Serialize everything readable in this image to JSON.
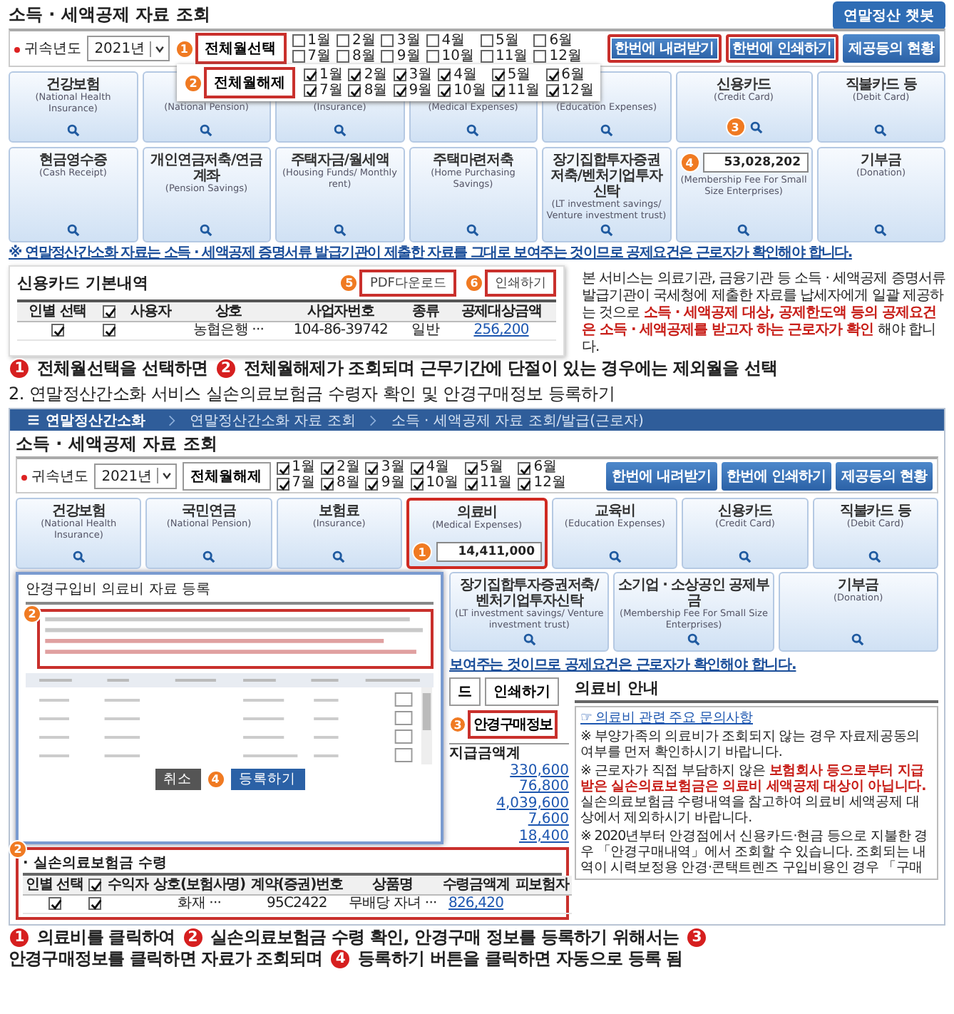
{
  "section_1": {
    "screen": {
      "title": "소득 · 세액공제 자료 조회",
      "chatbot_button": "연말정산 챗봇",
      "year_label": "귀속년도",
      "year_value": "2021년",
      "month_button": {
        "label": "전체월선택",
        "marker": "1"
      },
      "months": [
        {
          "label": "1월",
          "checked": false
        },
        {
          "label": "2월",
          "checked": false
        },
        {
          "label": "3월",
          "checked": false
        },
        {
          "label": "4월",
          "checked": false
        },
        {
          "label": "5월",
          "checked": false
        },
        {
          "label": "6월",
          "checked": false
        },
        {
          "label": "7월",
          "checked": false
        },
        {
          "label": "8월",
          "checked": false
        },
        {
          "label": "9월",
          "checked": false
        },
        {
          "label": "10월",
          "checked": false
        },
        {
          "label": "11월",
          "checked": false
        },
        {
          "label": "12월",
          "checked": false
        }
      ],
      "action_buttons": [
        {
          "label": "한번에 내려받기",
          "highlighted": true
        },
        {
          "label": "한번에 인쇄하기",
          "highlighted": true
        },
        {
          "label": "제공등의 현황",
          "highlighted": false
        }
      ],
      "month_popup": {
        "button": {
          "label": "전체월해제",
          "marker": "2"
        },
        "months": [
          {
            "label": "1월",
            "checked": true
          },
          {
            "label": "2월",
            "checked": true
          },
          {
            "label": "3월",
            "checked": true
          },
          {
            "label": "4월",
            "checked": true
          },
          {
            "label": "5월",
            "checked": true
          },
          {
            "label": "6월",
            "checked": true
          },
          {
            "label": "7월",
            "checked": true
          },
          {
            "label": "8월",
            "checked": true
          },
          {
            "label": "9월",
            "checked": true
          },
          {
            "label": "10월",
            "checked": true
          },
          {
            "label": "11월",
            "checked": true
          },
          {
            "label": "12월",
            "checked": true
          }
        ]
      },
      "tiles": [
        {
          "name": "건강보험",
          "english": "(National Health Insurance)"
        },
        {
          "english": "(National Pension)"
        },
        {
          "english": "(Insurance)"
        },
        {
          "english": "(Medical Expenses)"
        },
        {
          "english": "(Education Expenses)"
        },
        {
          "name": "신용카드",
          "english": "(Credit Card)",
          "marker": "3"
        },
        {
          "name": "직불카드 등",
          "english": "(Debit Card)"
        },
        {
          "name": "현금영수증",
          "english": "(Cash Receipt)"
        },
        {
          "name": "개인연금저축/연금계좌",
          "english": "(Pension Savings)"
        },
        {
          "name": "주택자금/월세액",
          "english": "(Housing Funds/ Monthly rent)"
        },
        {
          "name": "주택마련저축",
          "english": "(Home Purchasing Savings)"
        },
        {
          "name": "장기집합투자증권저축/벤처기업투자신탁",
          "english": "(LT investment savings/ Venture investment trust)"
        },
        {
          "english": "(Membership Fee For Small Size Enterprises)",
          "value": "53,028,202",
          "marker": "4"
        },
        {
          "name": "기부금",
          "english": "(Donation)"
        }
      ],
      "notice": "※ 연말정산간소화 자료는 소득 · 세액공제 증명서류 발급기관이 제출한 자료를 그대로 보여주는 것이므로 공제요건은 근로자가 확인해야 합니다.",
      "card_details": {
        "title": "신용카드 기본내역",
        "buttons": [
          {
            "label": "PDF다운로드",
            "marker": "5"
          },
          {
            "label": "인쇄하기",
            "marker": "6"
          }
        ],
        "columns": [
          {
            "kind": "text",
            "label": "인별 선택"
          },
          {
            "kind": "check",
            "checked": true
          },
          {
            "kind": "text",
            "label": "사용자"
          },
          {
            "kind": "text",
            "label": "상호"
          },
          {
            "kind": "text",
            "label": "사업자번호"
          },
          {
            "kind": "text",
            "label": "종류"
          },
          {
            "kind": "text",
            "label": "공제대상금액"
          }
        ],
        "rows": [
          [
            {
              "kind": "check",
              "checked": true
            },
            {
              "kind": "check",
              "checked": true
            },
            {
              "kind": "blank"
            },
            {
              "kind": "text",
              "text": "농협은행 ···"
            },
            {
              "kind": "text",
              "text": "104-86-39742"
            },
            {
              "kind": "text",
              "text": "일반"
            },
            {
              "kind": "link",
              "text": "256,200"
            }
          ]
        ]
      },
      "side_note": [
        {
          "text": "본 서비스는 의료기관, 금융기관 등 소득 · 세액공제 증명서류 발급기관이 국세청에 제출한 자료를 납세자에게 일괄 제공하는 것으로 ",
          "emphasis": false
        },
        {
          "text": "소득 · 세액공제 대상, 공제한도액 등의 공제요건은 소득 · 세액공제를 받고자 하는 근로자가 확인",
          "emphasis": true
        },
        {
          "text": " 해야 합니다.",
          "emphasis": false
        }
      ]
    },
    "caption": [
      {
        "kind": "marker",
        "text": "1"
      },
      {
        "kind": "text",
        "text": "전체월선택을 선택하면"
      },
      {
        "kind": "marker",
        "text": "2"
      },
      {
        "kind": "text",
        "text": "전체월해제가 조회되며 근무기간에 단절이 있는 경우에는 제외월을 선택"
      }
    ]
  },
  "section_2": {
    "heading": "2. 연말정산간소화 서비스 실손의료보험금 수령자 확인 및 안경구매정보 등록하기",
    "screen": {
      "nav": {
        "menu": "연말정산간소화",
        "breadcrumbs": [
          "연말정산간소화 자료 조회",
          "소득 · 세액공제 자료 조회/발급(근로자)"
        ]
      },
      "title": "소득 · 세액공제 자료 조회",
      "year_label": "귀속년도",
      "year_value": "2021년",
      "month_button": {
        "label": "전체월해제"
      },
      "months": [
        {
          "label": "1월",
          "checked": true
        },
        {
          "label": "2월",
          "checked": true
        },
        {
          "label": "3월",
          "checked": true
        },
        {
          "label": "4월",
          "checked": true
        },
        {
          "label": "5월",
          "checked": true
        },
        {
          "label": "6월",
          "checked": true
        },
        {
          "label": "7월",
          "checked": true
        },
        {
          "label": "8월",
          "checked": true
        },
        {
          "label": "9월",
          "checked": true
        },
        {
          "label": "10월",
          "checked": true
        },
        {
          "label": "11월",
          "checked": true
        },
        {
          "label": "12월",
          "checked": true
        }
      ],
      "action_buttons": [
        {
          "label": "한번에 내려받기",
          "highlighted": false
        },
        {
          "label": "한번에 인쇄하기",
          "highlighted": false
        },
        {
          "label": "제공등의 현황",
          "highlighted": false
        }
      ],
      "tiles": [
        {
          "name": "건강보험",
          "english": "(National Health Insurance)",
          "highlighted": false
        },
        {
          "name": "국민연금",
          "english": "(National Pension)",
          "highlighted": false
        },
        {
          "name": "보험료",
          "english": "(Insurance)",
          "highlighted": false
        },
        {
          "name": "의료비",
          "english": "(Medical Expenses)",
          "value": "14,411,000",
          "marker": "1",
          "highlighted": true
        },
        {
          "name": "교육비",
          "english": "(Education Expenses)",
          "highlighted": false
        },
        {
          "name": "신용카드",
          "english": "(Credit Card)",
          "highlighted": false
        },
        {
          "name": "직불카드 등",
          "english": "(Debit Card)",
          "highlighted": false
        }
      ],
      "lower_tiles": [
        {
          "name": "장기집합투자증권저축/벤처기업투자신탁",
          "english": "(LT investment savings/ Venture investment trust)"
        },
        {
          "name": "소기업 · 소상공인 공제부금",
          "english": "(Membership Fee For Small Size Enterprises)"
        },
        {
          "name": "기부금",
          "english": "(Donation)"
        }
      ],
      "modal": {
        "title": "안경구입비 의료비 자료 등록",
        "notice_marker": "2",
        "buttons": [
          {
            "label": "취소",
            "kind": "secondary"
          },
          {
            "label": "등록하기",
            "kind": "primary",
            "marker": "4"
          }
        ]
      },
      "notice": "보여주는 것이므로 공제요건은 근로자가 확인해야 합니다.",
      "side_buttons": [
        "드",
        "인쇄하기"
      ],
      "glasses_button": {
        "label": "안경구매정보",
        "marker": "3"
      },
      "amount_header": "지급금액계",
      "amounts": [
        "330,600",
        "76,800",
        "4,039,600",
        "7,600",
        "18,400"
      ],
      "info": {
        "title": "의료비 안내",
        "link": "☞ 의료비 관련 주요 문의사항",
        "paragraphs": [
          [
            {
              "text": "※ 부양가족의 의료비가 조회되지 않는 경우 자료제공동의 여부를 먼저 확인하시기 바랍니다.",
              "emphasis": false
            }
          ],
          [
            {
              "text": "※ 근로자가 직접 부담하지 않은 ",
              "emphasis": false
            },
            {
              "text": "보험회사 등으로부터 지급받은 실손의료보험금은 의료비 세액공제 대상이 아닙니다.",
              "emphasis": true
            },
            {
              "text": " 실손의료보험금 수령내역을 참고하여 의료비 세액공제 대상에서 제외하시기 바랍니다.",
              "emphasis": false
            }
          ],
          [
            {
              "text": "※ 2020년부터 안경점에서 신용카드·현금 등으로 지불한 경우 「안경구매내역」에서 조회할 수 있습니다. 조회되는 내역이 시력보정용 안경·콘택트렌즈 구입비용인 경우 「구매",
              "emphasis": false
            }
          ]
        ]
      },
      "insurance": {
        "marker": "2",
        "title": "· 실손의료보험금 수령",
        "columns": [
          {
            "kind": "text",
            "label": "인별 선택"
          },
          {
            "kind": "check",
            "checked": true
          },
          {
            "kind": "text",
            "label": "수익자"
          },
          {
            "kind": "text",
            "label": "상호(보험사명)"
          },
          {
            "kind": "text",
            "label": "계약(증권)번호"
          },
          {
            "kind": "text",
            "label": "상품명"
          },
          {
            "kind": "text",
            "label": "수령금액계"
          },
          {
            "kind": "text",
            "label": "피보험자"
          }
        ],
        "rows": [
          [
            {
              "kind": "check",
              "checked": true
            },
            {
              "kind": "check",
              "checked": true
            },
            {
              "kind": "blank"
            },
            {
              "kind": "text",
              "text": "화재 ···"
            },
            {
              "kind": "text",
              "text": "95C2422"
            },
            {
              "kind": "text",
              "text": "무배당 자녀 ···"
            },
            {
              "kind": "link",
              "text": "826,420"
            },
            {
              "kind": "blank"
            }
          ]
        ]
      }
    },
    "caption": [
      {
        "kind": "marker",
        "text": "1"
      },
      {
        "kind": "text",
        "text": "의료비를 클릭하여"
      },
      {
        "kind": "marker",
        "text": "2"
      },
      {
        "kind": "text",
        "text": "실손의료보험금 수령 확인, 안경구매 정보를 등록하기 위해서는"
      },
      {
        "kind": "marker",
        "text": "3"
      },
      {
        "kind": "text",
        "text": "안경구매정보를 클릭하면 자료가 조회되며"
      },
      {
        "kind": "marker",
        "text": "4"
      },
      {
        "kind": "text",
        "text": "등록하기 버튼을 클릭하면 자동으로 등록 됨"
      }
    ]
  }
}
